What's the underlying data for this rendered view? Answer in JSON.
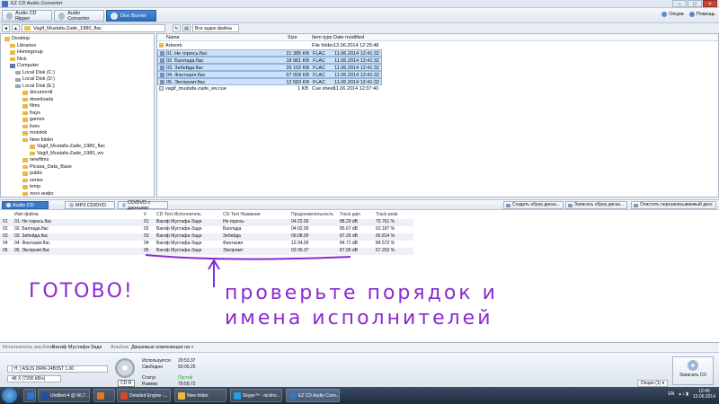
{
  "window": {
    "title": "EZ CD Audio Converter",
    "min": "–",
    "max": "□",
    "close": "×"
  },
  "toolbar": {
    "modes": [
      {
        "label": "Audio CD Ripper"
      },
      {
        "label": "Audio Converter"
      },
      {
        "label": "Disc Burner"
      }
    ],
    "options": "Опции",
    "help": "Помощь"
  },
  "pathbar": {
    "path": "Vagif_Mustafa-Zade_1980_flac",
    "filter": "Все аудио файлы"
  },
  "tree": [
    {
      "label": "Desktop",
      "kind": "folder"
    },
    {
      "label": "Libraries",
      "kind": "folder"
    },
    {
      "label": "Homegroup",
      "kind": "folder"
    },
    {
      "label": "Nick",
      "kind": "folder"
    },
    {
      "label": "Computer",
      "kind": "pc"
    },
    {
      "label": "Local Disk (C:)",
      "kind": "drive"
    },
    {
      "label": "Local Disk (D:)",
      "kind": "drive"
    },
    {
      "label": "Local Disk (E:)",
      "kind": "drive"
    },
    {
      "label": "documentl",
      "kind": "folder"
    },
    {
      "label": "downloads",
      "kind": "folder"
    },
    {
      "label": "films",
      "kind": "folder"
    },
    {
      "label": "frays",
      "kind": "folder"
    },
    {
      "label": "games",
      "kind": "folder"
    },
    {
      "label": "lives",
      "kind": "folder"
    },
    {
      "label": "molotok",
      "kind": "folder"
    },
    {
      "label": "New folder",
      "kind": "folder"
    },
    {
      "label": "Vagif_Mustafa-Zade_1980_flac",
      "kind": "folder"
    },
    {
      "label": "Vagif_Mustafa-Zade_1980_wv",
      "kind": "folder"
    },
    {
      "label": "newfilms",
      "kind": "folder"
    },
    {
      "label": "Picasa_Data_Base",
      "kind": "folder"
    },
    {
      "label": "public",
      "kind": "folder"
    },
    {
      "label": "series",
      "kind": "folder"
    },
    {
      "label": "temp",
      "kind": "folder"
    },
    {
      "label": "лого инфо",
      "kind": "folder"
    }
  ],
  "files": {
    "headers": {
      "name": "Name",
      "size": "Size",
      "type": "Item type",
      "date": "Date modified"
    },
    "rows": [
      {
        "name": "Artwork",
        "size": "",
        "type": "File folder",
        "date": "13.06.2014 12:25:48",
        "kind": "folder",
        "selected": false
      },
      {
        "name": "01. Не горюсь.flac",
        "size": "21 385 KB",
        "type": "FLAC",
        "date": "11.06.2014 12:41:32",
        "kind": "audio",
        "selected": true
      },
      {
        "name": "02. Баллада.flac",
        "size": "18 981 KB",
        "type": "FLAC",
        "date": "11.06.2014 12:41:32",
        "kind": "audio",
        "selected": true
      },
      {
        "name": "03. Зибейда.flac",
        "size": "29 102 KB",
        "type": "FLAC",
        "date": "11.06.2014 12:41:32",
        "kind": "audio",
        "selected": true
      },
      {
        "name": "04. Фантазия.flac",
        "size": "57 008 KB",
        "type": "FLAC",
        "date": "11.06.2014 12:41:32",
        "kind": "audio",
        "selected": true
      },
      {
        "name": "05. Экспромт.flac",
        "size": "12 583 KB",
        "type": "FLAC",
        "date": "11.06.2014 12:41:32",
        "kind": "audio",
        "selected": true
      },
      {
        "name": "vagif_mustafa-zade_wv.cue",
        "size": "1 KB",
        "type": "Cue sheet",
        "date": "11.06.2014 12:37:40",
        "kind": "cue",
        "selected": false
      }
    ]
  },
  "disc_tabs": [
    {
      "label": "Audio CD",
      "active": true
    },
    {
      "label": "MP3 CD/DVD",
      "active": false
    },
    {
      "label": "CD/DVD с данными",
      "active": false
    }
  ],
  "actions": {
    "create_image": "Создать образ диска...",
    "write_image": "Записать образ диска...",
    "erase": "Очистить перезаписываемый диск"
  },
  "tracks": {
    "headers": {
      "filename": "Имя файла",
      "num": "#",
      "artist": "CD-Text Исполнитель",
      "title": "CD-Text Название",
      "duration": "Продолжительность",
      "gain": "Track gain",
      "peak": "Track peak"
    },
    "rows": [
      {
        "idx": "01",
        "filename": "01. Не горюсь.flac",
        "num": "01",
        "artist": "Вагиф Мустафа-Заде",
        "title": "Не горюсь",
        "duration": "04:22.00",
        "gain": "88.29 dB",
        "peak": "70.761 %"
      },
      {
        "idx": "02",
        "filename": "02. Баллада.flac",
        "num": "02",
        "artist": "Вагиф Мустафа-Заде",
        "title": "Баллада",
        "duration": "04:02.00",
        "gain": "85.67 dB",
        "peak": "63.187 %"
      },
      {
        "idx": "03",
        "filename": "03. Зибейда.flac",
        "num": "03",
        "artist": "Вагиф Мустафа-Заде",
        "title": "Зибейда",
        "duration": "06:08.00",
        "gain": "87.26 dB",
        "peak": "65.814 %"
      },
      {
        "idx": "04",
        "filename": "04. Фантазия.flac",
        "num": "04",
        "artist": "Вагиф Мустафа-Заде",
        "title": "Фантазия",
        "duration": "12:34.00",
        "gain": "84.71 dB",
        "peak": "84.572 %"
      },
      {
        "idx": "05",
        "filename": "05. Экспромт.flac",
        "num": "05",
        "artist": "Вагиф Мустафа-Заде",
        "title": "Экспромт",
        "duration": "02:35.37",
        "gain": "87.95 dB",
        "peak": "57.202 %"
      }
    ]
  },
  "annotation": {
    "ready": "ГОТОВО!",
    "check_line1": "проверьте порядок и",
    "check_line2": "имена исполнителей",
    "ink_color": "#8a2bd0"
  },
  "meta": {
    "album_artist_label": "Исполнитель альбома",
    "album_artist": "Вагиф Мустафа-Заде",
    "album_label": "Альбом",
    "album": "Джазовые композиции на т"
  },
  "bottom": {
    "drive": "[ H: ] ASUS DRW-24B3ST 1.00",
    "speed": "48 X (7200 kB/s)",
    "disc_type": "CD-R",
    "used_label": "Используется",
    "used": "29:53.37",
    "free_label": "Свободно",
    "free": "50:05.25",
    "status_label": "Статус",
    "status": "Пустой",
    "size_label": "Размер",
    "size": "79:59.72",
    "options_btn": "Опции (1) ▾",
    "burn": "Записать CD"
  },
  "taskbar": {
    "tasks": [
      {
        "label": "",
        "color": "#2a78c8"
      },
      {
        "label": "Untitled-4 @ 66,7...",
        "color": "#1f4fa0"
      },
      {
        "label": "",
        "color": "#e0782a"
      },
      {
        "label": "Detailed Engine -...",
        "color": "#d34a2a"
      },
      {
        "label": "New folder",
        "color": "#e7b94a"
      },
      {
        "label": "Skype™ - nickho...",
        "color": "#1fa0e0"
      },
      {
        "label": "EZ CD Audio Conv...",
        "color": "#3e73b9"
      }
    ],
    "lang": "EN",
    "time": "12:45",
    "date": "13.06.2014"
  }
}
